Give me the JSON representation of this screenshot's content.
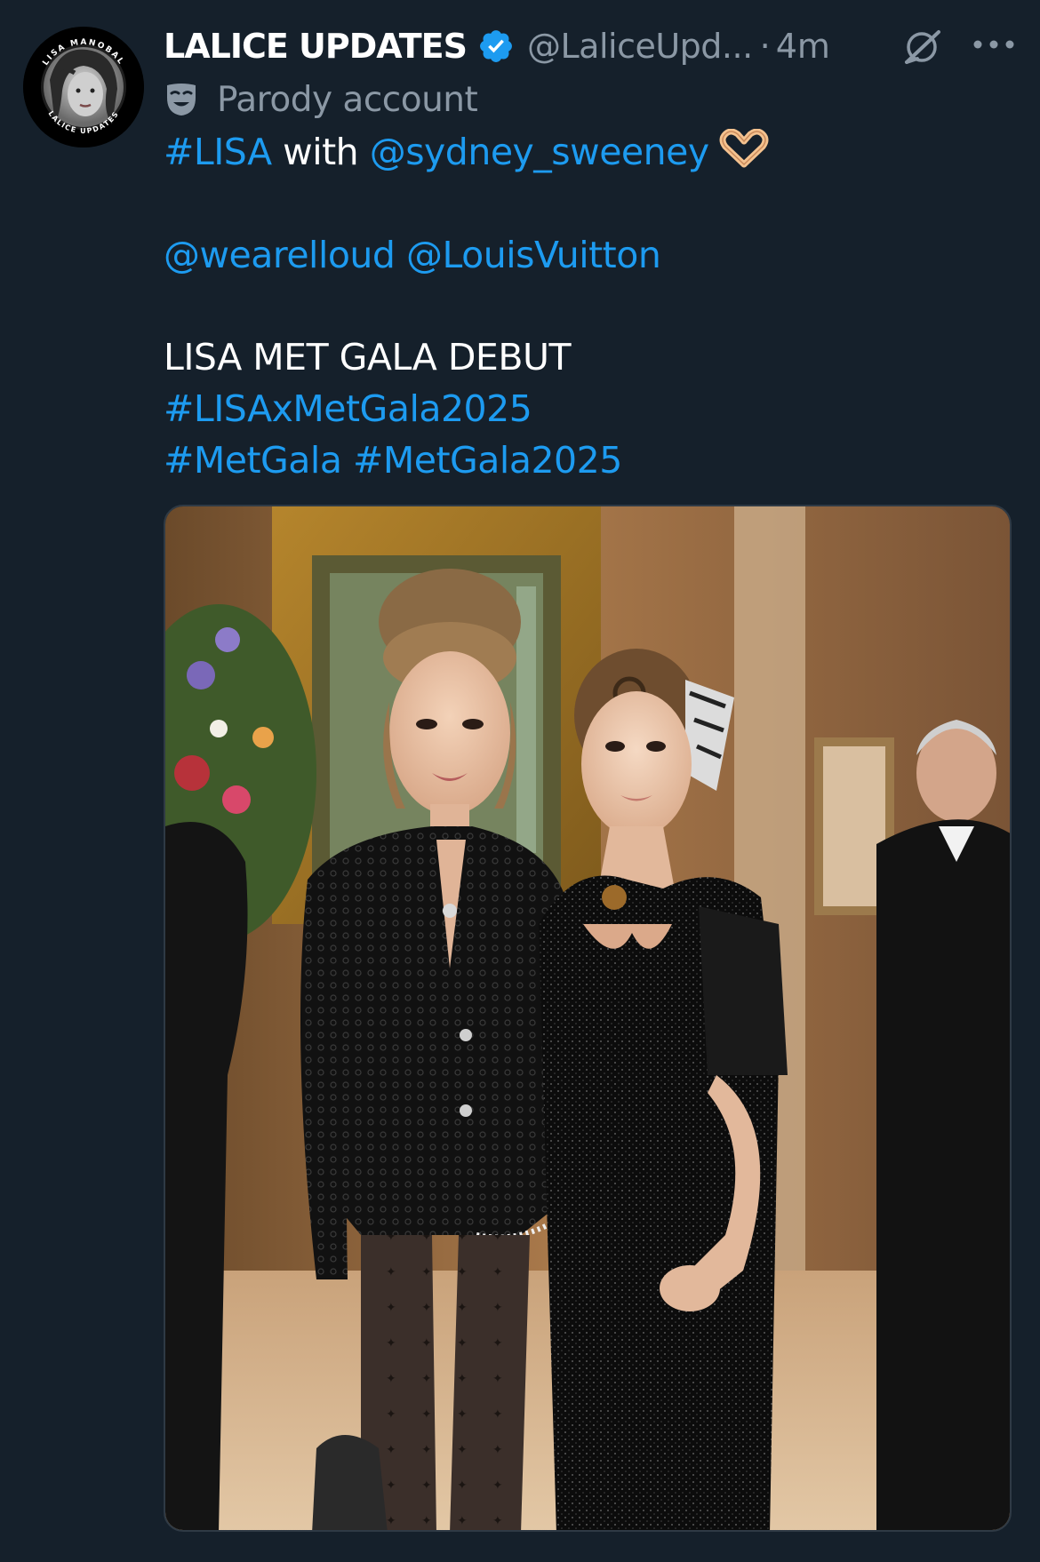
{
  "author": {
    "display_name": "LALICE UPDATES",
    "handle": "@LaliceUpd...",
    "separator": "·",
    "timestamp": "4m",
    "verified": true,
    "verified_color": "#1d9bf0",
    "label": "Parody account",
    "label_icon": "theater-mask-icon",
    "avatar_ring_text_top": "LISA MANOBAL",
    "avatar_ring_text_bottom": "LALICE UPDATES"
  },
  "tweet": {
    "line1": {
      "hashtag": "#LISA",
      "word": " with ",
      "mention": "@sydney_sweeney",
      "emoji": "heart-hands-icon"
    },
    "line2": {
      "mention1": "@wearelloud",
      "mention2": "@LouisVuitton"
    },
    "line3": "LISA MET GALA DEBUT",
    "line4": "#LISAxMetGala2025",
    "line5": {
      "hashtag1": "#MetGala",
      "hashtag2": "#MetGala2025"
    }
  },
  "media": {
    "type": "photo"
  },
  "actions": {
    "grok_icon": "grok-icon",
    "more_icon": "more-options-icon"
  },
  "colors": {
    "background": "#15202b",
    "link": "#1d9bf0",
    "secondary_text": "#8b98a5",
    "primary_text": "#ffffff"
  }
}
